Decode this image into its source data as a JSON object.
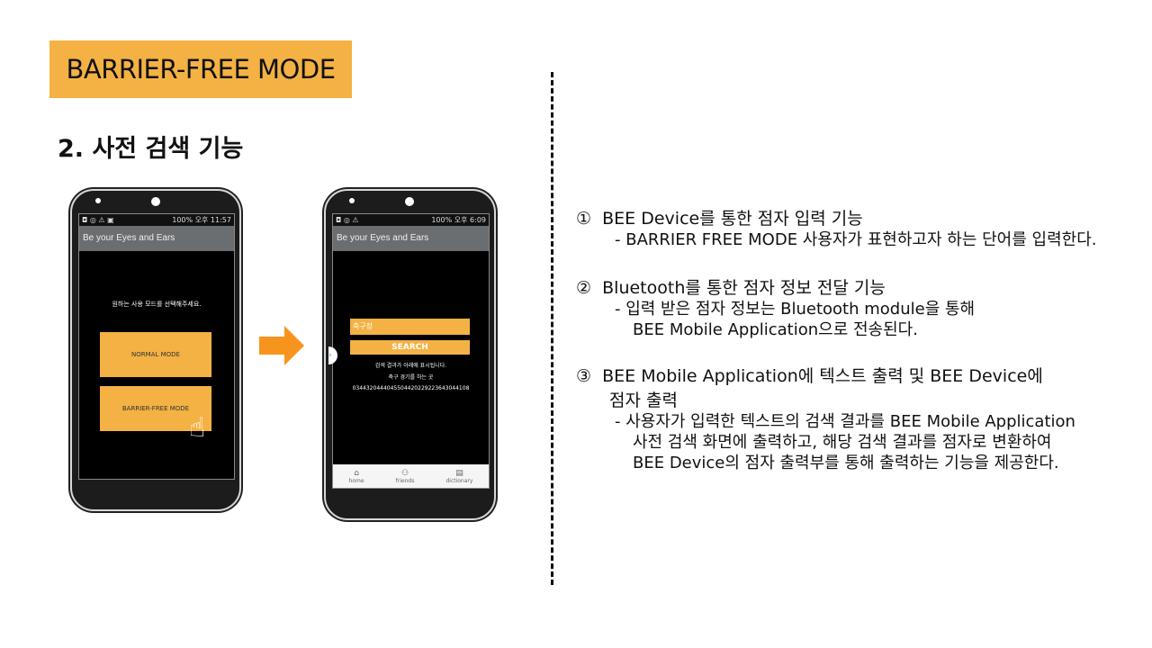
{
  "header": {
    "badge": "BARRIER-FREE MODE",
    "subtitle": "2. 사전 검색 기능"
  },
  "phone1": {
    "status_time": "오후 11:57",
    "status_battery": "100%",
    "app_title": "Be your Eyes and Ears",
    "prompt": "원하는 사용 모드를 선택해주세요.",
    "normal_mode": "NORMAL MODE",
    "barrier_free_mode": "BARRIER-FREE MODE"
  },
  "phone2": {
    "status_time": "오후 6:09",
    "status_battery": "100%",
    "app_title": "Be your Eyes and Ears",
    "search_value": "축구장",
    "search_button": "SEARCH",
    "result_notice": "검색 결과가 아래에 표시됩니다.",
    "result_meaning": "축구 경기를 하는 곳",
    "result_braille": "0344320444045504420229223643044108",
    "nav": [
      "home",
      "friends",
      "dictionary"
    ]
  },
  "features": [
    {
      "num": "①",
      "title": "BEE Device를 통한 점자 입력 기능",
      "desc": [
        "- BARRIER FREE MODE 사용자가 표현하고자 하는 단어를 입력한다."
      ]
    },
    {
      "num": "②",
      "title": "Bluetooth를 통한 점자 정보 전달 기능",
      "desc": [
        "- 입력 받은 점자 정보는 Bluetooth module을 통해",
        "BEE Mobile Application으로 전송된다."
      ]
    },
    {
      "num": "③",
      "title": "BEE Mobile Application에 텍스트 출력 및 BEE Device에",
      "title2": "점자 출력",
      "desc": [
        "- 사용자가 입력한 텍스트의 검색 결과를 BEE Mobile Application",
        "사전 검색 화면에 출력하고, 해당 검색 결과를 점자로 변환하여",
        "BEE Device의 점자 출력부를 통해 출력하는 기능을 제공한다."
      ]
    }
  ],
  "colors": {
    "accent": "#f4b144",
    "arrow": "#f7941d"
  }
}
